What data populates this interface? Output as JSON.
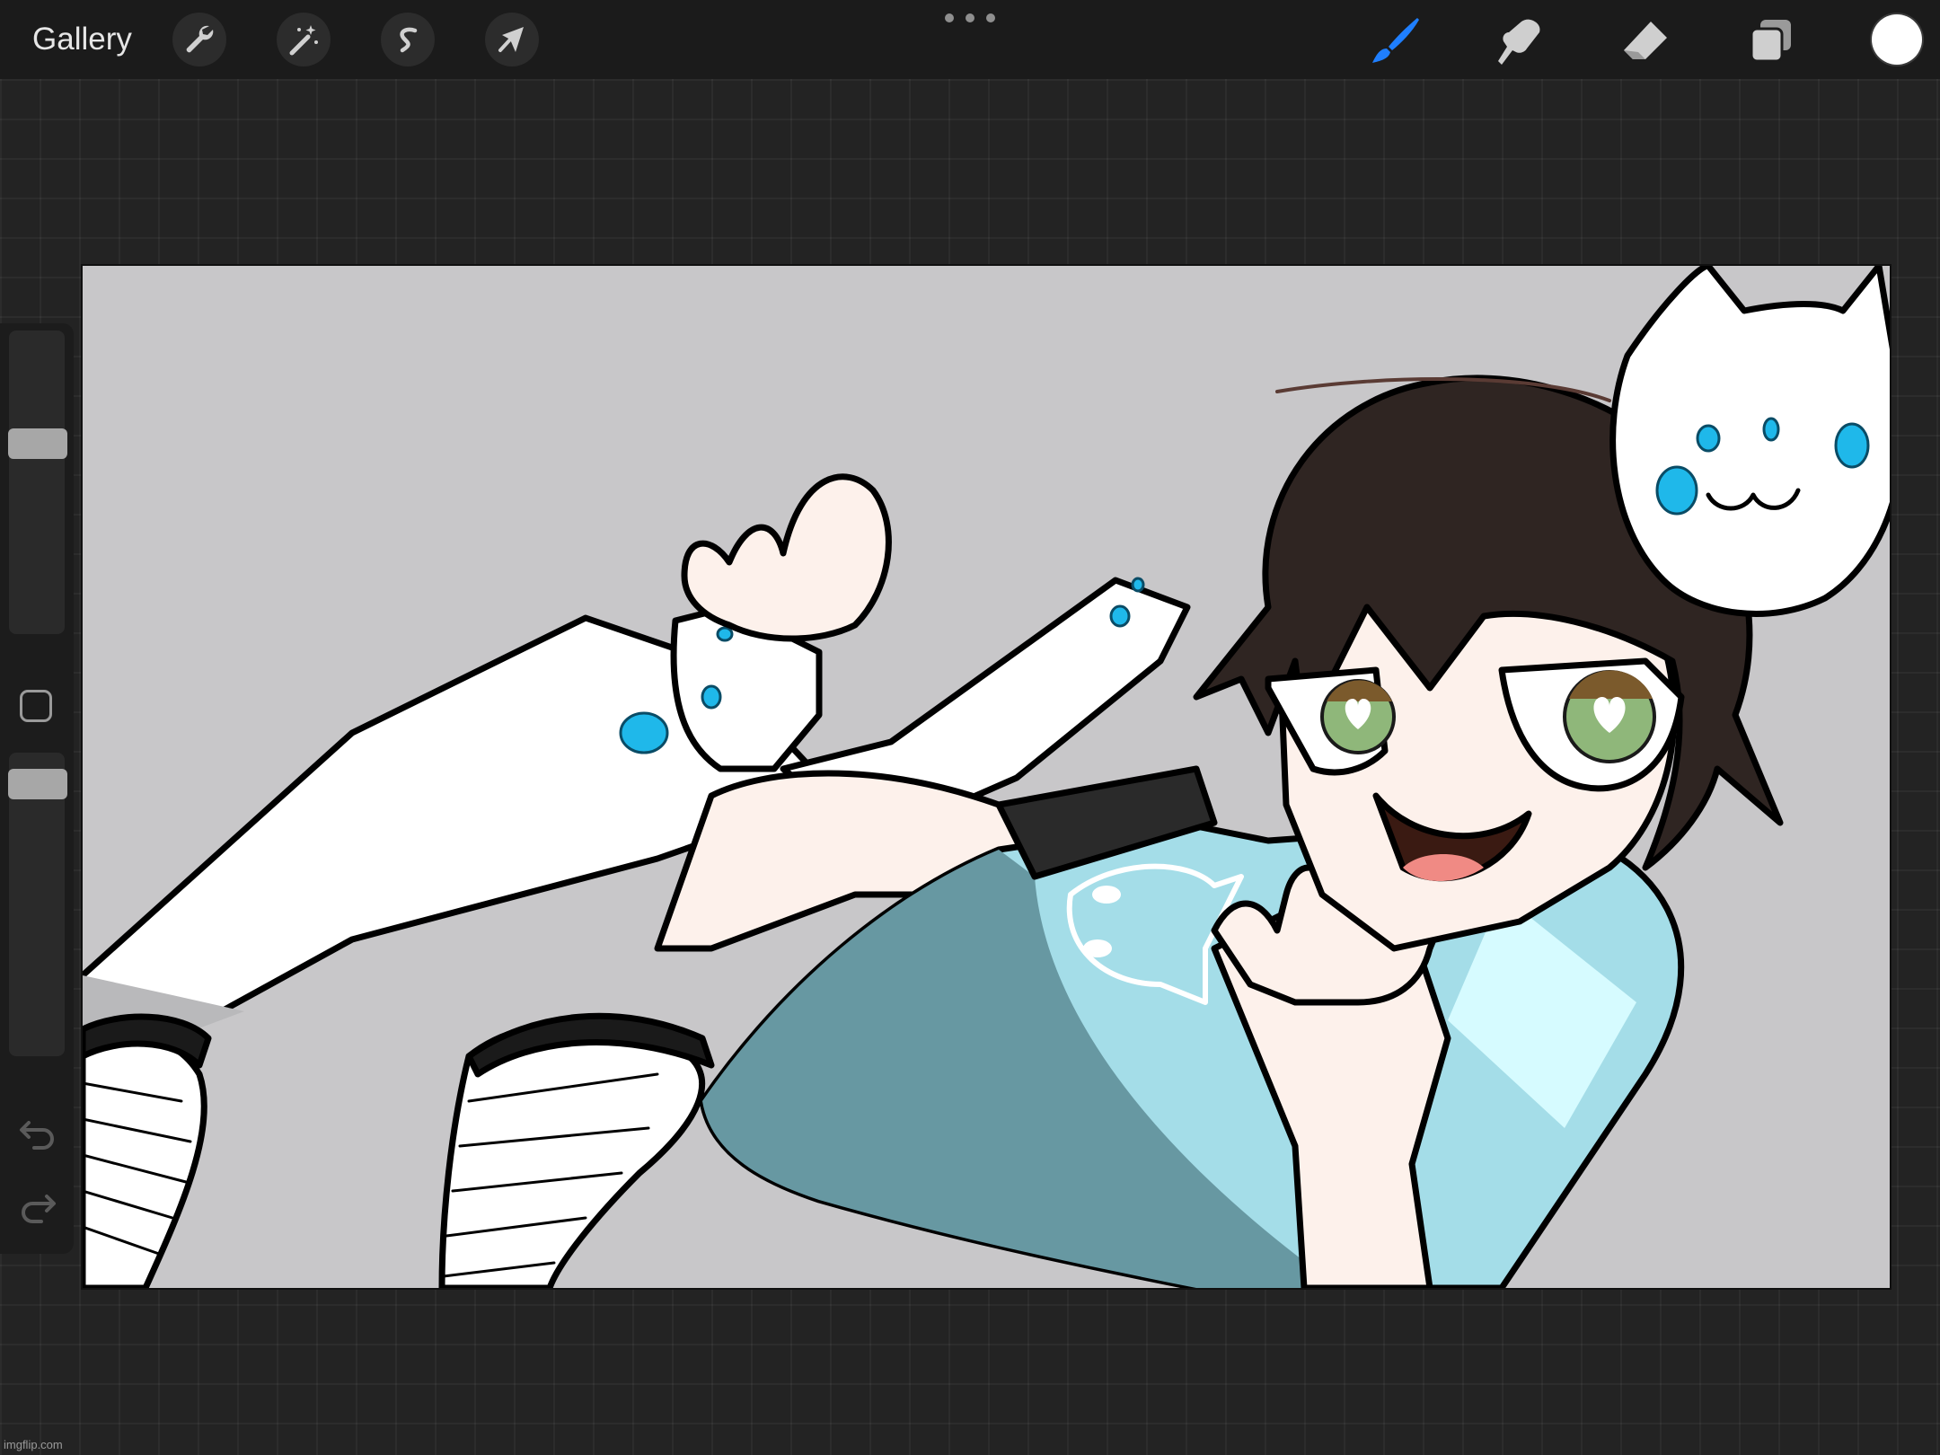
{
  "toolbar": {
    "gallery_label": "Gallery",
    "left_tools": [
      {
        "name": "actions",
        "icon": "wrench-icon"
      },
      {
        "name": "adjustments",
        "icon": "magic-wand-icon"
      },
      {
        "name": "selection",
        "icon": "selection-s-icon"
      },
      {
        "name": "transform",
        "icon": "arrow-cursor-icon"
      }
    ],
    "right_tools": [
      {
        "name": "brush",
        "icon": "brush-icon",
        "active": true
      },
      {
        "name": "smudge",
        "icon": "smudge-finger-icon"
      },
      {
        "name": "eraser",
        "icon": "eraser-icon"
      },
      {
        "name": "layers",
        "icon": "layers-icon"
      }
    ],
    "active_color": "#ffffff",
    "accent_color": "#1f7fff"
  },
  "sidebar": {
    "brush_size_level": 0.36,
    "opacity_level": 0.06
  },
  "canvas": {
    "background_color": "#c8c7c9"
  },
  "watermark": "imgflip.com"
}
